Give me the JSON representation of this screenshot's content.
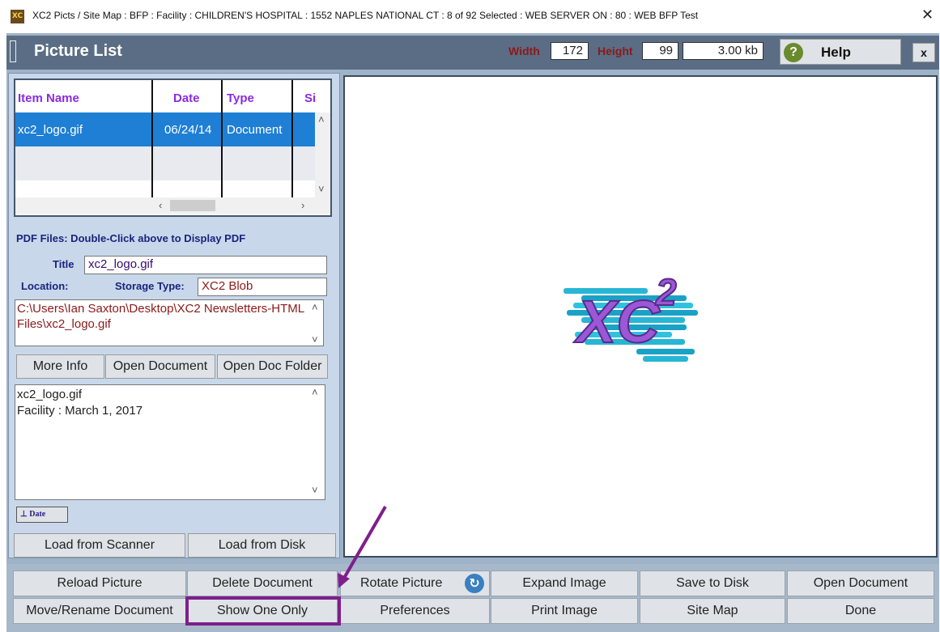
{
  "window": {
    "title": "XC2 Picts / Site Map :  BFP : Facility : CHILDREN'S HOSPITAL : 1552 NAPLES NATIONAL CT : 8 of 92 Selected : WEB SERVER ON : 80 : WEB BFP Test",
    "close": "✕"
  },
  "header": {
    "title": "Picture List",
    "width_label": "Width",
    "width_value": "172",
    "height_label": "Height",
    "height_value": "99",
    "size_value": "3.00 kb",
    "help_label": "Help",
    "close_label": "x"
  },
  "list": {
    "columns": [
      "Item Name",
      "Date",
      "Type",
      "Si"
    ],
    "rows": [
      {
        "name": "xc2_logo.gif",
        "date": "06/24/14",
        "type": "Document"
      }
    ]
  },
  "details": {
    "pdf_note": "PDF Files:  Double-Click above to Display PDF",
    "title_label": "Title",
    "title_value": "xc2_logo.gif",
    "location_label": "Location:",
    "storage_label": "Storage Type:",
    "storage_value": "XC2 Blob",
    "path_value": "C:\\Users\\Ian Saxton\\Desktop\\XC2 Newsletters-HTML Files\\xc2_logo.gif",
    "notes_line1": "xc2_logo.gif",
    "notes_line2": "Facility  :  March 1, 2017",
    "date_button": "Date"
  },
  "left_buttons": {
    "more_info": "More Info",
    "open_document": "Open Document",
    "open_doc_folder": "Open Doc Folder",
    "load_scanner": "Load from Scanner",
    "load_disk": "Load from Disk"
  },
  "preview": {
    "logo_text": "XC",
    "logo_sup": "2"
  },
  "bottom_buttons": {
    "reload_picture": "Reload Picture",
    "delete_document": "Delete Document",
    "rotate_picture": "Rotate Picture",
    "expand_image": "Expand Image",
    "save_to_disk": "Save to Disk",
    "open_document": "Open Document",
    "move_rename": "Move/Rename Document",
    "show_one_only": "Show One Only",
    "preferences": "Preferences",
    "print_image": "Print Image",
    "site_map": "Site Map",
    "done": "Done"
  },
  "colors": {
    "header_bg": "#5a6d85",
    "panel_bg": "#c8d8ea",
    "selection": "#1e7fd4",
    "annotation": "#7e1f8c"
  }
}
